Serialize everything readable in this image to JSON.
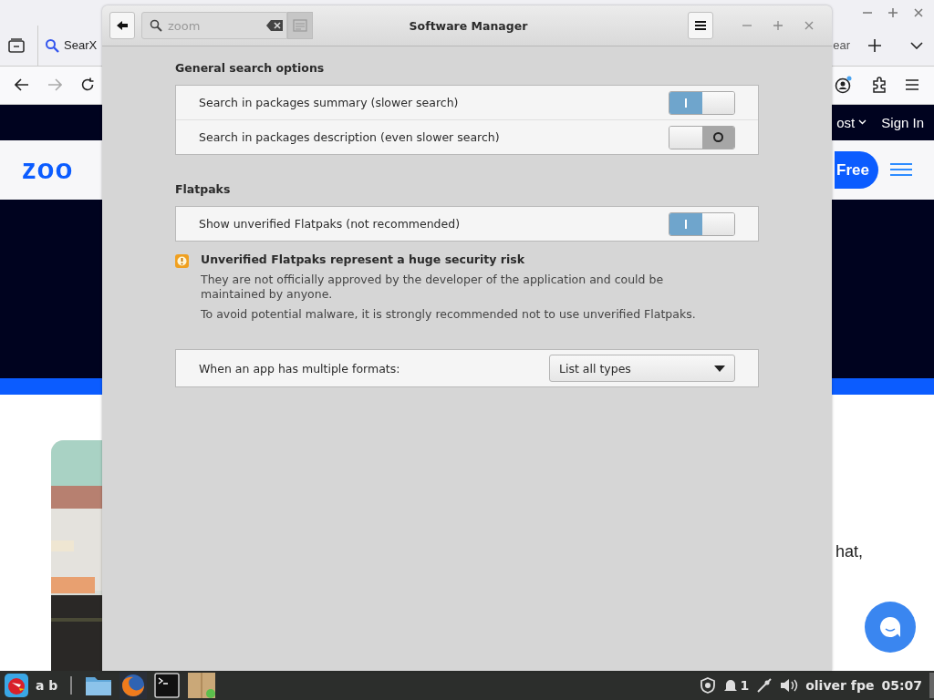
{
  "browser": {
    "tabs": [
      {
        "label": "SearX",
        "selected": true
      },
      {
        "label": "ear",
        "selected": false
      }
    ],
    "page": {
      "nav_link": "ost",
      "sign_in": "Sign In",
      "logo": "zoo",
      "cta": "Free",
      "body_text": "hat,"
    }
  },
  "app": {
    "title": "Software Manager",
    "search": {
      "value": "zoom"
    },
    "sections": [
      {
        "heading": "General search options",
        "rows": [
          {
            "label": "Search in packages summary (slower search)",
            "on": true
          },
          {
            "label": "Search in packages description (even slower search)",
            "on": false
          }
        ]
      },
      {
        "heading": "Flatpaks",
        "rows": [
          {
            "label": "Show unverified Flatpaks (not recommended)",
            "on": true
          }
        ]
      }
    ],
    "warning": {
      "title": "Unverified Flatpaks represent a huge security risk",
      "paragraphs": [
        "They are not officially approved by the developer of the application and could be maintained by anyone.",
        "To avoid potential malware, it is strongly recommended not to use unverified Flatpaks."
      ]
    },
    "format_row": {
      "label": "When an app has multiple formats:",
      "value": "List all types"
    }
  },
  "taskbar": {
    "start_label": "a b",
    "notification_count": "1",
    "user": "oliver fpe",
    "clock": "05:07"
  }
}
